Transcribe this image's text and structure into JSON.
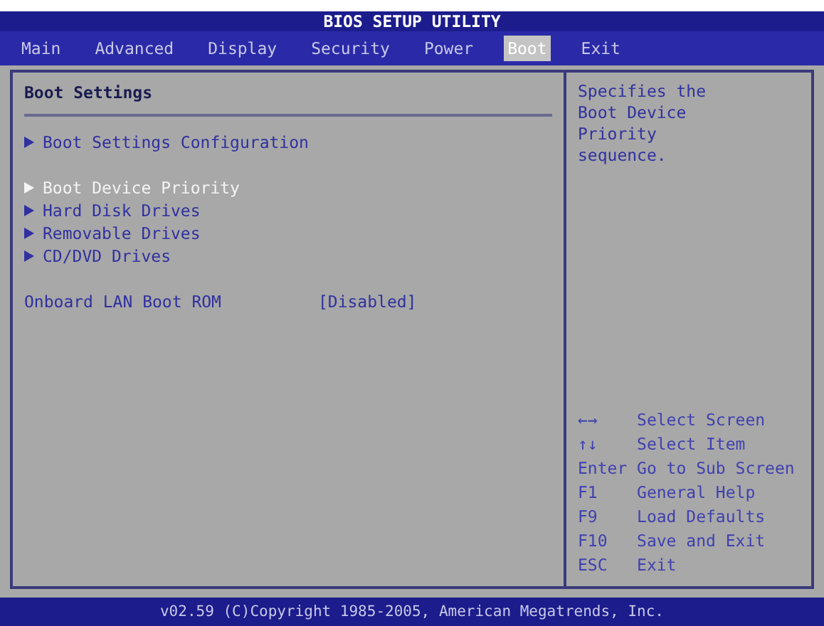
{
  "window": {
    "title": "BIOS SETUP UTILITY"
  },
  "tabs": [
    {
      "label": "Main",
      "selected": false
    },
    {
      "label": "Advanced",
      "selected": false
    },
    {
      "label": "Display",
      "selected": false
    },
    {
      "label": "Security",
      "selected": false
    },
    {
      "label": "Power",
      "selected": false
    },
    {
      "label": "Boot",
      "selected": true
    },
    {
      "label": "Exit",
      "selected": false
    }
  ],
  "panel": {
    "title": "Boot Settings",
    "groups": [
      [
        {
          "kind": "submenu",
          "label": "Boot Settings Configuration",
          "selected": false
        }
      ],
      [
        {
          "kind": "submenu",
          "label": "Boot Device Priority",
          "selected": true
        },
        {
          "kind": "submenu",
          "label": "Hard Disk Drives",
          "selected": false
        },
        {
          "kind": "submenu",
          "label": "Removable Drives",
          "selected": false
        },
        {
          "kind": "submenu",
          "label": "CD/DVD Drives",
          "selected": false
        }
      ],
      [
        {
          "kind": "setting",
          "label": "Onboard LAN Boot ROM",
          "value": "[Disabled]",
          "selected": false
        }
      ]
    ]
  },
  "help": {
    "text": "Specifies the Boot Device Priority sequence.",
    "keys": [
      {
        "key": "←→",
        "action": "Select Screen"
      },
      {
        "key": "↑↓",
        "action": "Select Item"
      },
      {
        "key": "Enter",
        "action": "Go to Sub Screen"
      },
      {
        "key": "F1",
        "action": "General Help"
      },
      {
        "key": "F9",
        "action": "Load Defaults"
      },
      {
        "key": "F10",
        "action": "Save and Exit"
      },
      {
        "key": "ESC",
        "action": "Exit"
      }
    ]
  },
  "status_bar": "v02.59 (C)Copyright 1985-2005, American Megatrends, Inc."
}
